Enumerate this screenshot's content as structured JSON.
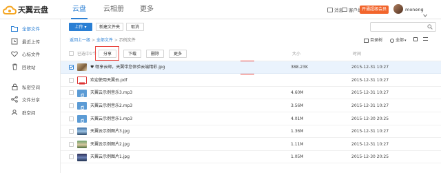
{
  "brand": {
    "logo_text": "天翼云盘",
    "accent": "#2a7fd4",
    "vip_color": "#f2652c"
  },
  "top_nav": {
    "tabs": [
      {
        "label": "云盘"
      },
      {
        "label": "云相册"
      },
      {
        "label": "更多"
      }
    ]
  },
  "top_right": {
    "messages_label": "消息",
    "client_label": "客户端",
    "vip_label": "开通超级会员",
    "username": "moneng"
  },
  "sidebar": {
    "items": [
      {
        "label": "全部文件"
      },
      {
        "label": "最近上传"
      },
      {
        "label": "心标文件"
      },
      {
        "label": "回收站"
      },
      {
        "label": "私密空间"
      },
      {
        "label": "文件分享"
      },
      {
        "label": "群空间"
      }
    ]
  },
  "toolbar": {
    "upload_label": "上传",
    "new_folder_label": "新建文件夹",
    "cancel_label": "取消"
  },
  "breadcrumb": {
    "back_label": "返回上一级",
    "root_label": "全部文件",
    "current_label": "示例文件",
    "sep": ">"
  },
  "view_options": {
    "directory_label": "目录树",
    "sort_label": "全部"
  },
  "selection": {
    "selected_count_label": "已选中1个",
    "share_label": "分享",
    "download_label": "下载",
    "delete_label": "删除",
    "more_label": "更多"
  },
  "columns": {
    "size": "大小",
    "time": "时间"
  },
  "files": [
    {
      "name": "♥ 畅享云邮，天翼带您体验云端精彩.jpg",
      "size": "388.23K",
      "date": "2015-12-31 10:27",
      "thumb": "photo",
      "selected": true
    },
    {
      "name": "欢迎使用天翼云.pdf",
      "size": "",
      "date": "2015-12-31 10:27",
      "thumb": "pdf",
      "selected": false
    },
    {
      "name": "天翼云示例音乐3.mp3",
      "size": "4.60M",
      "date": "2015-12-31 10:27",
      "thumb": "audio",
      "selected": false
    },
    {
      "name": "天翼云示例音乐2.mp3",
      "size": "3.56M",
      "date": "2015-12-31 10:27",
      "thumb": "audio",
      "selected": false
    },
    {
      "name": "天翼云示例音乐1.mp3",
      "size": "4.01M",
      "date": "2015-12-30 20:25",
      "thumb": "audio",
      "selected": false
    },
    {
      "name": "天翼云示例图片3.jpg",
      "size": "1.36M",
      "date": "2015-12-31 10:27",
      "thumb": "photo2",
      "selected": false
    },
    {
      "name": "天翼云示例图片2.jpg",
      "size": "1.11M",
      "date": "2015-12-31 10:27",
      "thumb": "photo3",
      "selected": false
    },
    {
      "name": "天翼云示例图片1.jpg",
      "size": "1.05M",
      "date": "2015-12-30 20:25",
      "thumb": "photo4",
      "selected": false
    }
  ]
}
